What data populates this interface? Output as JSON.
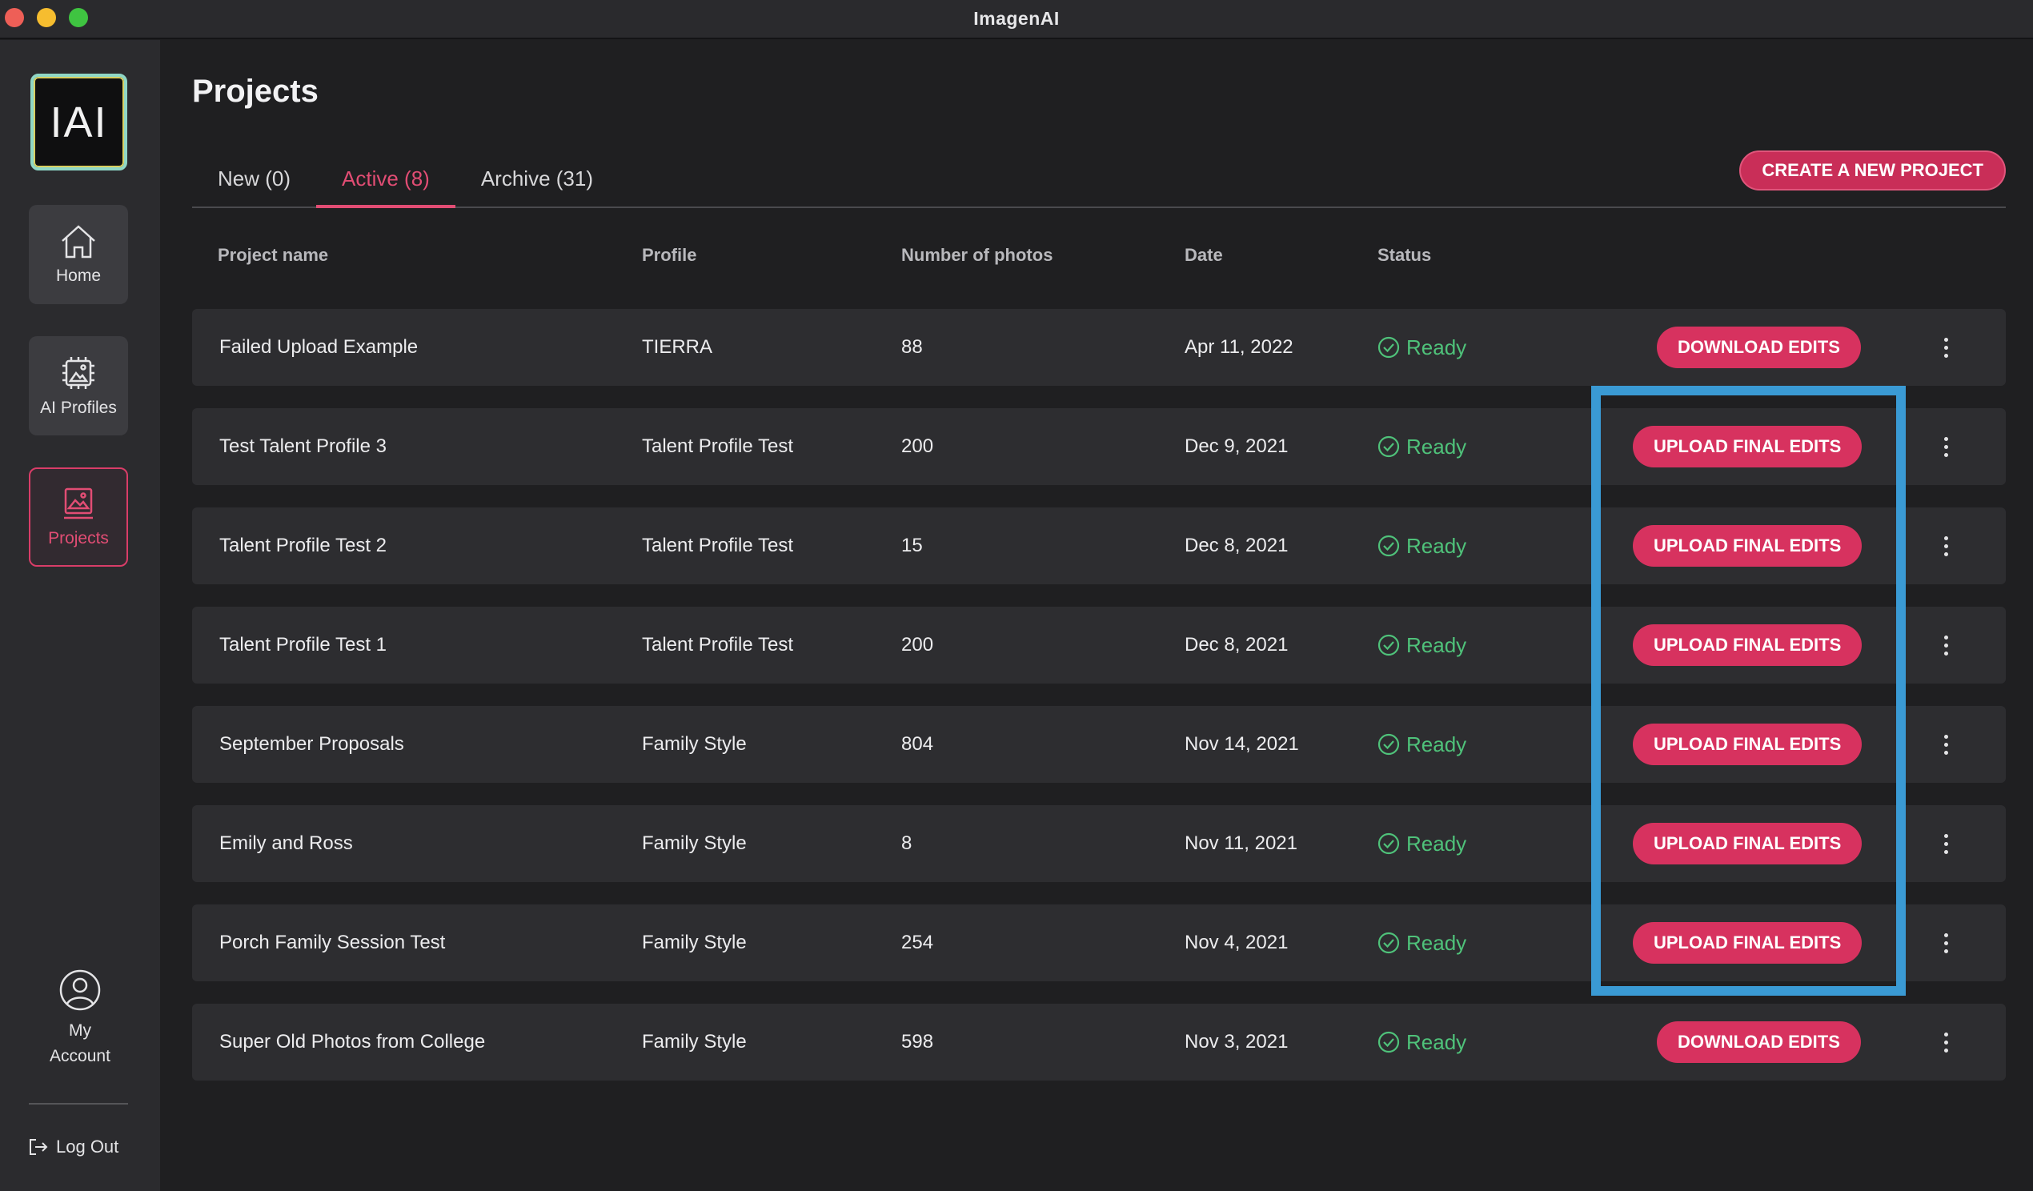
{
  "window": {
    "title": "ImagenAI"
  },
  "sidebar": {
    "logo_text": "IAI",
    "items": [
      {
        "label": "Home",
        "icon": "home-icon"
      },
      {
        "label": "AI Profiles",
        "icon": "ai-chip-icon"
      },
      {
        "label": "Projects",
        "icon": "image-folder-icon",
        "active": true
      }
    ],
    "account_label": "My Account",
    "logout_label": "Log Out"
  },
  "page": {
    "title": "Projects"
  },
  "tabs": [
    {
      "label": "New (0)"
    },
    {
      "label": "Active (8)",
      "active": true
    },
    {
      "label": "Archive (31)"
    }
  ],
  "create_button_label": "CREATE A NEW PROJECT",
  "table": {
    "headers": [
      "Project name",
      "Profile",
      "Number of photos",
      "Date",
      "Status"
    ],
    "rows": [
      {
        "name": "Failed Upload Example",
        "profile": "TIERRA",
        "photos": "88",
        "date": "Apr 11, 2022",
        "status": "Ready",
        "action": "DOWNLOAD EDITS"
      },
      {
        "name": "Test Talent Profile 3",
        "profile": "Talent Profile Test",
        "photos": "200",
        "date": "Dec 9, 2021",
        "status": "Ready",
        "action": "UPLOAD FINAL EDITS"
      },
      {
        "name": "Talent Profile Test 2",
        "profile": "Talent Profile Test",
        "photos": "15",
        "date": "Dec 8, 2021",
        "status": "Ready",
        "action": "UPLOAD FINAL EDITS"
      },
      {
        "name": "Talent Profile Test 1",
        "profile": "Talent Profile Test",
        "photos": "200",
        "date": "Dec 8, 2021",
        "status": "Ready",
        "action": "UPLOAD FINAL EDITS"
      },
      {
        "name": "September Proposals",
        "profile": "Family Style",
        "photos": "804",
        "date": "Nov 14, 2021",
        "status": "Ready",
        "action": "UPLOAD FINAL EDITS"
      },
      {
        "name": "Emily and Ross",
        "profile": "Family Style",
        "photos": "8",
        "date": "Nov 11, 2021",
        "status": "Ready",
        "action": "UPLOAD FINAL EDITS"
      },
      {
        "name": "Porch Family Session Test",
        "profile": "Family Style",
        "photos": "254",
        "date": "Nov 4, 2021",
        "status": "Ready",
        "action": "UPLOAD FINAL EDITS"
      },
      {
        "name": "Super Old Photos from College",
        "profile": "Family Style",
        "photos": "598",
        "date": "Nov 3, 2021",
        "status": "Ready",
        "action": "DOWNLOAD EDITS"
      }
    ]
  },
  "colors": {
    "accent": "#d7325f",
    "status_ready": "#4fc27a",
    "highlight": "#3a9ad4"
  }
}
